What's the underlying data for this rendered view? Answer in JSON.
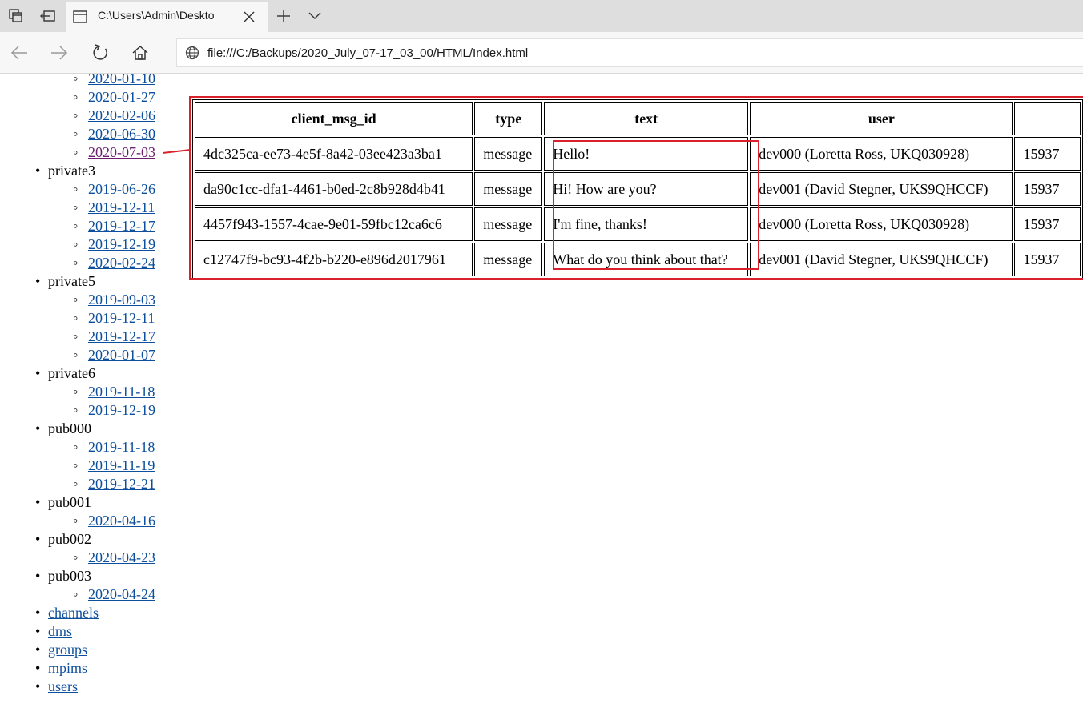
{
  "browser": {
    "tab_title": "C:\\Users\\Admin\\Deskto",
    "address": "file:///C:/Backups/2020_July_07-17_03_00/HTML/Index.html"
  },
  "sidebar": {
    "top_dates": [
      "2020-01-10",
      "2020-01-27",
      "2020-02-06",
      "2020-06-30",
      "2020-07-03"
    ],
    "groups": [
      {
        "name": "private3",
        "dates": [
          "2019-06-26",
          "2019-12-11",
          "2019-12-17",
          "2019-12-19",
          "2020-02-24"
        ]
      },
      {
        "name": "private5",
        "dates": [
          "2019-09-03",
          "2019-12-11",
          "2019-12-17",
          "2020-01-07"
        ]
      },
      {
        "name": "private6",
        "dates": [
          "2019-11-18",
          "2019-12-19"
        ]
      },
      {
        "name": "pub000",
        "dates": [
          "2019-11-18",
          "2019-11-19",
          "2019-12-21"
        ]
      },
      {
        "name": "pub001",
        "dates": [
          "2020-04-16"
        ]
      },
      {
        "name": "pub002",
        "dates": [
          "2020-04-23"
        ]
      },
      {
        "name": "pub003",
        "dates": [
          "2020-04-24"
        ]
      }
    ],
    "links": [
      "channels",
      "dms",
      "groups",
      "mpims",
      "users"
    ]
  },
  "table": {
    "headers": [
      "client_msg_id",
      "type",
      "text",
      "user",
      ""
    ],
    "rows": [
      [
        "4dc325ca-ee73-4e5f-8a42-03ee423a3ba1",
        "message",
        "Hello!",
        "dev000 (Loretta Ross, UKQ030928)",
        "15937"
      ],
      [
        "da90c1cc-dfa1-4461-b0ed-2c8b928d4b41",
        "message",
        "Hi! How are you?",
        "dev001 (David Stegner, UKS9QHCCF)",
        "15937"
      ],
      [
        "4457f943-1557-4cae-9e01-59fbc12ca6c6",
        "message",
        "I'm fine, thanks!",
        "dev000 (Loretta Ross, UKQ030928)",
        "15937"
      ],
      [
        "c12747f9-bc93-4f2b-b220-e896d2017961",
        "message",
        "What do you think about that?",
        "dev001 (David Stegner, UKS9QHCCF)",
        "15937"
      ]
    ]
  },
  "colors": {
    "link": "#0d4f9c",
    "visited_link": "#6b1e6e",
    "highlight": "#d9212c"
  }
}
